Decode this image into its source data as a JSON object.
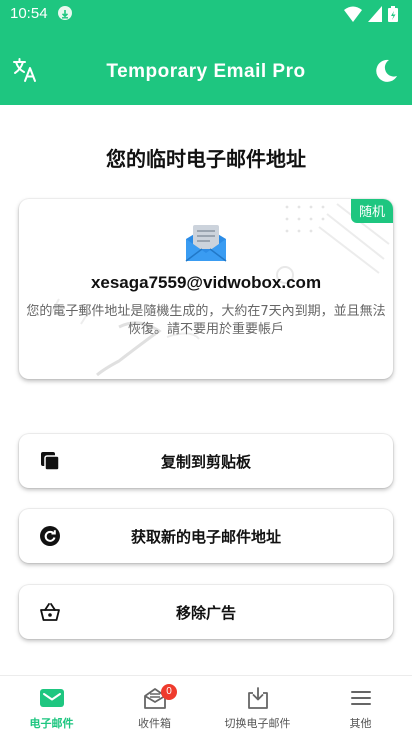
{
  "status_bar": {
    "time": "10:54"
  },
  "app_bar": {
    "title": "Temporary Email Pro"
  },
  "page": {
    "heading": "您的临时电子邮件地址"
  },
  "email_card": {
    "badge": "随机",
    "address": "xesaga7559@vidwobox.com",
    "note": "您的電子郵件地址是隨機生成的，大約在7天內到期，並且無法恢復。請不要用於重要帳戶"
  },
  "actions": {
    "copy_label": "复制到剪贴板",
    "new_label": "获取新的电子邮件地址",
    "remove_ads_label": "移除广告"
  },
  "bottom_nav": {
    "items": [
      {
        "label": "电子邮件",
        "icon": "mail-icon"
      },
      {
        "label": "收件箱",
        "icon": "inbox-icon",
        "badge": "0"
      },
      {
        "label": "切换电子邮件",
        "icon": "download-icon"
      },
      {
        "label": "其他",
        "icon": "menu-icon"
      }
    ]
  },
  "colors": {
    "accent": "#1ec680",
    "badge_red": "#ef3b2d"
  }
}
